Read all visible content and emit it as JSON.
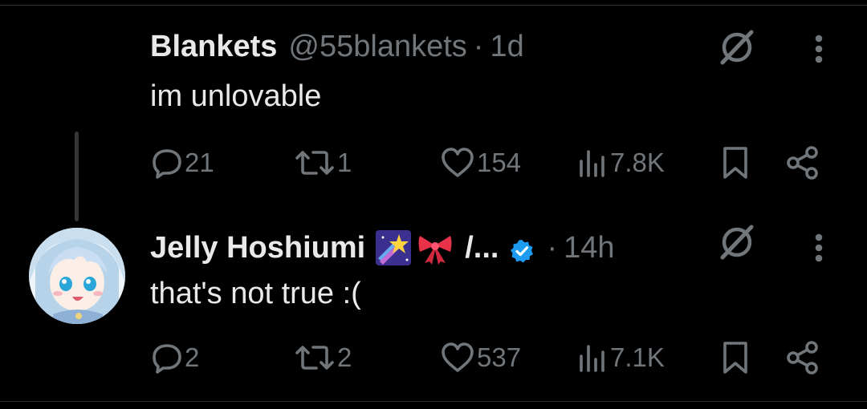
{
  "colors": {
    "background": "#000000",
    "text_primary": "#e7e9ea",
    "text_secondary": "#71767b",
    "verified_blue": "#1d9bf0",
    "divider": "#2f3336"
  },
  "tweets": [
    {
      "display_name": "Blankets",
      "handle": "@55blankets",
      "separator": "·",
      "time": "1d",
      "text": "im unlovable",
      "stats": {
        "replies": "21",
        "reposts": "1",
        "likes": "154",
        "views": "7.8K"
      },
      "icons": [
        "grok-icon",
        "more-vertical-icon",
        "reply-icon",
        "repost-icon",
        "like-icon",
        "views-icon",
        "bookmark-icon",
        "share-icon"
      ]
    },
    {
      "display_name": "Jelly Hoshiumi",
      "name_suffix": "/...",
      "separator": "·",
      "time": "14h",
      "verified": true,
      "text": "that's not true :(",
      "stats": {
        "replies": "2",
        "reposts": "2",
        "likes": "537",
        "views": "7.1K"
      },
      "icons": [
        "avatar",
        "shooting-star-emoji",
        "ribbon-emoji",
        "verified-badge-icon",
        "grok-icon",
        "more-vertical-icon",
        "reply-icon",
        "repost-icon",
        "like-icon",
        "views-icon",
        "bookmark-icon",
        "share-icon"
      ]
    }
  ]
}
